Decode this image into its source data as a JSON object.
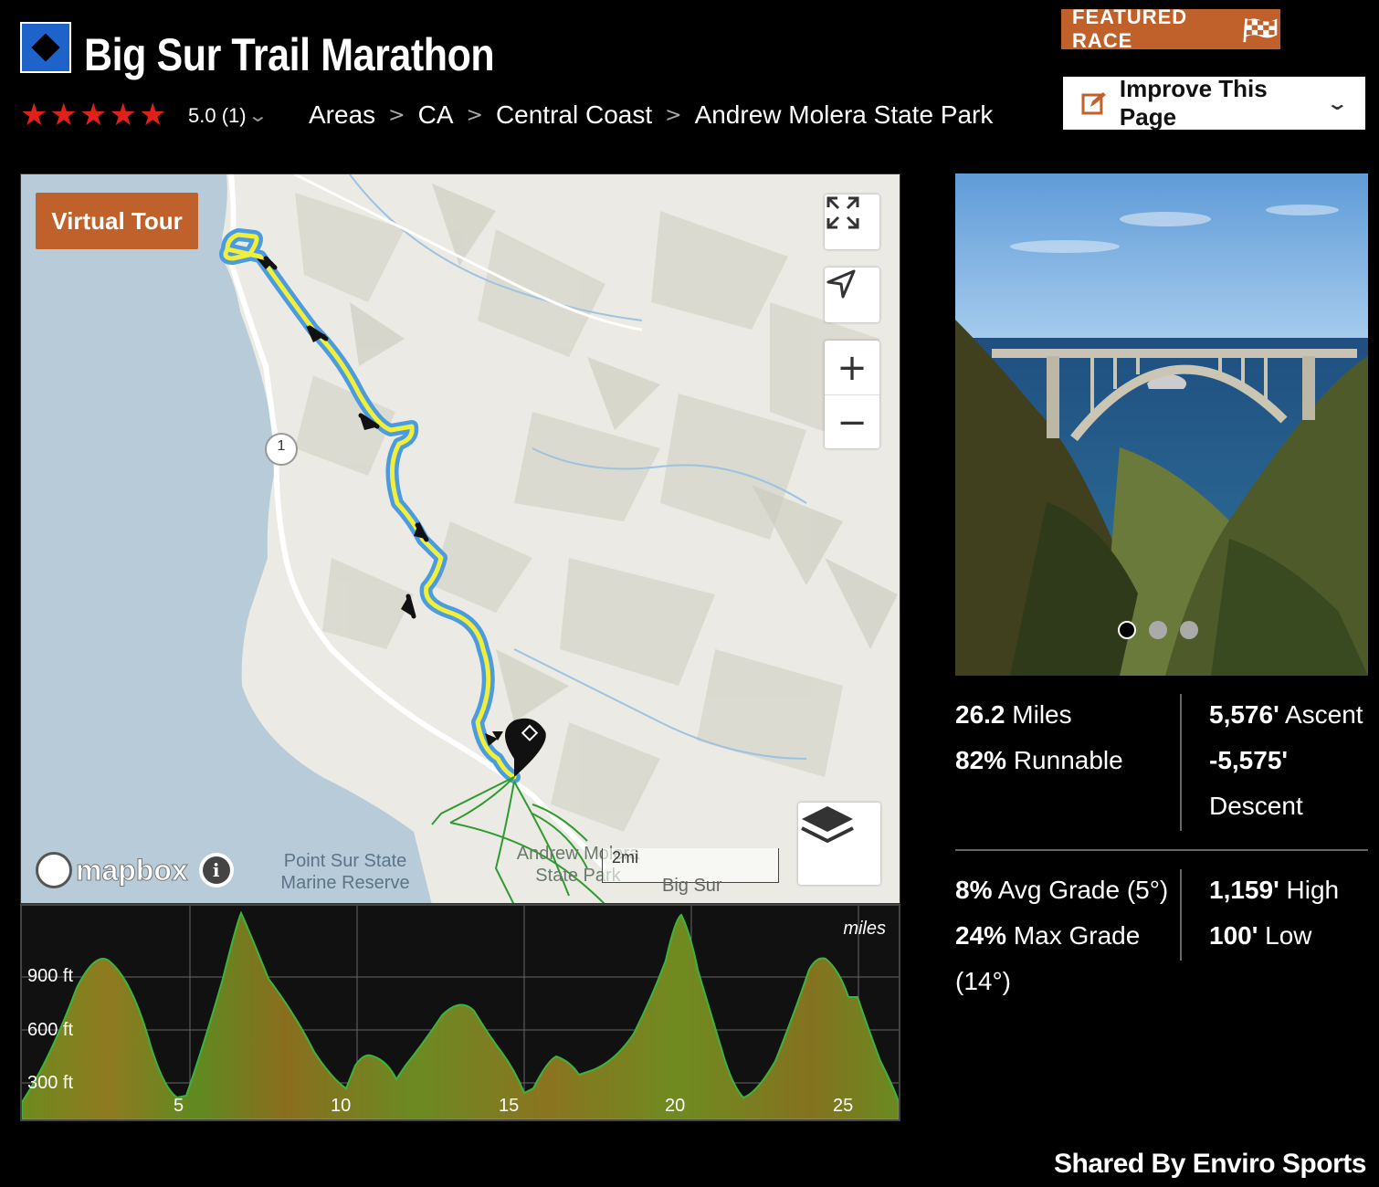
{
  "header": {
    "title": "Big Sur Trail Marathon",
    "difficulty_icon": "black-diamond-icon",
    "rating": "5.0 (1)",
    "stars": 5,
    "star_color": "#e0201b",
    "featured_label": "FEATURED RACE",
    "improve_label": "Improve This Page",
    "accent": "#c0612b"
  },
  "breadcrumb": [
    "Areas",
    "CA",
    "Central Coast",
    "Andrew Molera State Park"
  ],
  "map": {
    "virtual_tour": "Virtual Tour",
    "route_marker": "1",
    "label_reserve_line1": "Point Sur State",
    "label_reserve_line2": "Marine Reserve",
    "label_park_line1": "Andrew Molera",
    "label_park_line2": "State Park",
    "label_town": "Big Sur",
    "scale": "2mi",
    "attribution": "mapbox",
    "route_color": "#f2ef3a",
    "route_outline_color": "#4a9be0"
  },
  "elevation": {
    "unit": "miles",
    "y_labels": [
      "900 ft",
      "600 ft",
      "300 ft"
    ],
    "x_labels": [
      "5",
      "10",
      "15",
      "20",
      "25"
    ]
  },
  "stats": {
    "miles_value": "26.2",
    "miles_label": "Miles",
    "runnable_value": "82%",
    "runnable_label": "Runnable",
    "ascent_value": "5,576'",
    "ascent_label": "Ascent",
    "descent_value": "-5,575'",
    "descent_label": "Descent",
    "avg_grade_value": "8%",
    "avg_grade_label": "Avg Grade (5°)",
    "max_grade_value": "24%",
    "max_grade_label": "Max Grade",
    "max_grade_deg": "(14°)",
    "high_value": "1,159'",
    "high_label": "High",
    "low_value": "100'",
    "low_label": "Low"
  },
  "footer": {
    "shared_by": "Shared By Enviro Sports"
  }
}
